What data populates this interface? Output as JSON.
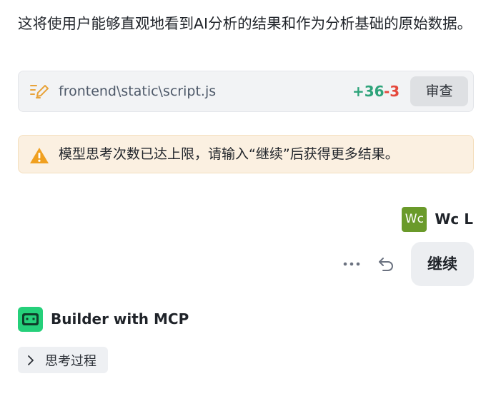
{
  "message": {
    "text": "这将使用户能够直观地看到AI分析的结果和作为分析基础的原始数据。"
  },
  "file_change": {
    "icon": "edit-file-icon",
    "path": "frontend\\static\\script.js",
    "additions": "+36",
    "deletions": "-3",
    "review_label": "审查",
    "accent_add": "#2ea37a",
    "accent_del": "#e5483c"
  },
  "warning": {
    "icon": "warning-icon",
    "text": "模型思考次数已达上限，请输入“继续”后获得更多结果。",
    "color": "#f0a020"
  },
  "user": {
    "avatar_text": "Wc",
    "name": "Wc L",
    "message": "继续",
    "actions": [
      "more-icon",
      "undo-icon"
    ]
  },
  "assistant": {
    "name": "Builder with MCP",
    "avatar_icon": "bot-icon",
    "avatar_color": "#25d07a",
    "think_label": "思考过程"
  }
}
